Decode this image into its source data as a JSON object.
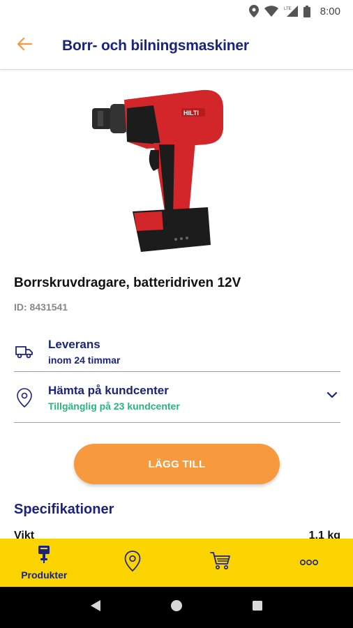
{
  "status_bar": {
    "time": "8:00",
    "network": "LTE"
  },
  "app_bar": {
    "title": "Borr- och bilningsmaskiner"
  },
  "product": {
    "name": "Borrskruvdragare, batteridriven 12V",
    "id": "ID: 8431541"
  },
  "delivery": {
    "title": "Leverans",
    "subtitle": "inom 24 timmar"
  },
  "pickup": {
    "title": "Hämta på kundcenter",
    "subtitle": "Tillgänglig på 23 kundcenter"
  },
  "add_button": {
    "label": "LÄGG TILL"
  },
  "specs": {
    "heading": "Specifikationer",
    "rows": [
      {
        "label": "Vikt",
        "value": "1.1 kg"
      }
    ]
  },
  "bottom_nav": {
    "items": [
      {
        "label": "Produkter",
        "icon": "drill-icon",
        "active": true
      },
      {
        "label": "",
        "icon": "location-pin-icon"
      },
      {
        "label": "",
        "icon": "cart-icon"
      },
      {
        "label": "",
        "icon": "more-icon"
      }
    ]
  },
  "colors": {
    "primary": "#1a237e",
    "accent": "#f79a3e",
    "nav_bg": "#fbd400",
    "available": "#2bb57a"
  }
}
